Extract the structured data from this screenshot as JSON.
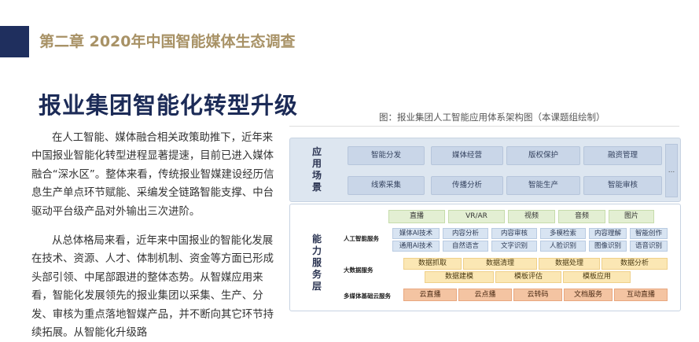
{
  "header": {
    "chapter": "第二章 2020年中国智能媒体生态调查"
  },
  "title": "报业集团智能化转型升级",
  "paragraphs": [
    "在人工智能、媒体融合相关政策助推下，近年来中国报业智能化转型进程显著提速，目前已进入媒体融合“深水区”。整体来看，传统报业智媒建设经历信息生产单点环节赋能、采编发全链路智能支撑、中台驱动平台级产品对外输出三次进阶。",
    "从总体格局来看，近年来中国报业的智能化发展在技术、资源、人才、体制机制、资金等方面已形成头部引领、中尾部跟进的整体态势。从智媒应用来看，智能化发展领先的报业集团以采集、生产、分发、审核为重点落地智媒产品，并不断向其它环节持续拓展。从智能化升级路"
  ],
  "figure": {
    "caption": "图：报业集团人工智能应用体系架构图（本课题组绘制）",
    "app_layer": {
      "label": "应用场景",
      "row1": [
        "智能分发",
        "媒体经营",
        "版权保护",
        "融资管理"
      ],
      "row2": [
        "线索采集",
        "传播分析",
        "智能生产",
        "智能审核"
      ],
      "more": "..."
    },
    "capability_layer": {
      "label": "能力服务层",
      "media_types": [
        "直播",
        "VR/AR",
        "视频",
        "音频",
        "图片"
      ],
      "ai_services": {
        "label": "人工智能服务",
        "row1": [
          "媒体AI技术",
          "内容分析",
          "内容审核",
          "多模检索",
          "内容理解",
          "智能创作"
        ],
        "row2": [
          "通用AI技术",
          "自然语言",
          "文字识别",
          "人脸识别",
          "图像识别",
          "语音识别"
        ]
      },
      "big_data": {
        "label": "大数据服务",
        "row1": [
          "数据抓取",
          "数据清理",
          "数据处理",
          "数据分析"
        ],
        "row2": [
          "数据建模",
          "模板评估",
          "模板应用"
        ]
      },
      "cloud": {
        "label": "多媒体基础云服务",
        "items": [
          "云直播",
          "云点播",
          "云转码",
          "文档服务",
          "互动直播"
        ]
      }
    }
  },
  "colors": {
    "navy": "#1f2f5e",
    "gold": "#a89266",
    "title": "#1c2b57",
    "app_bg": "#dde6f0",
    "green": "#e3efd3",
    "blue": "#d8e4f2",
    "yellow": "#fbe7b4",
    "orange": "#f4c4a2"
  }
}
